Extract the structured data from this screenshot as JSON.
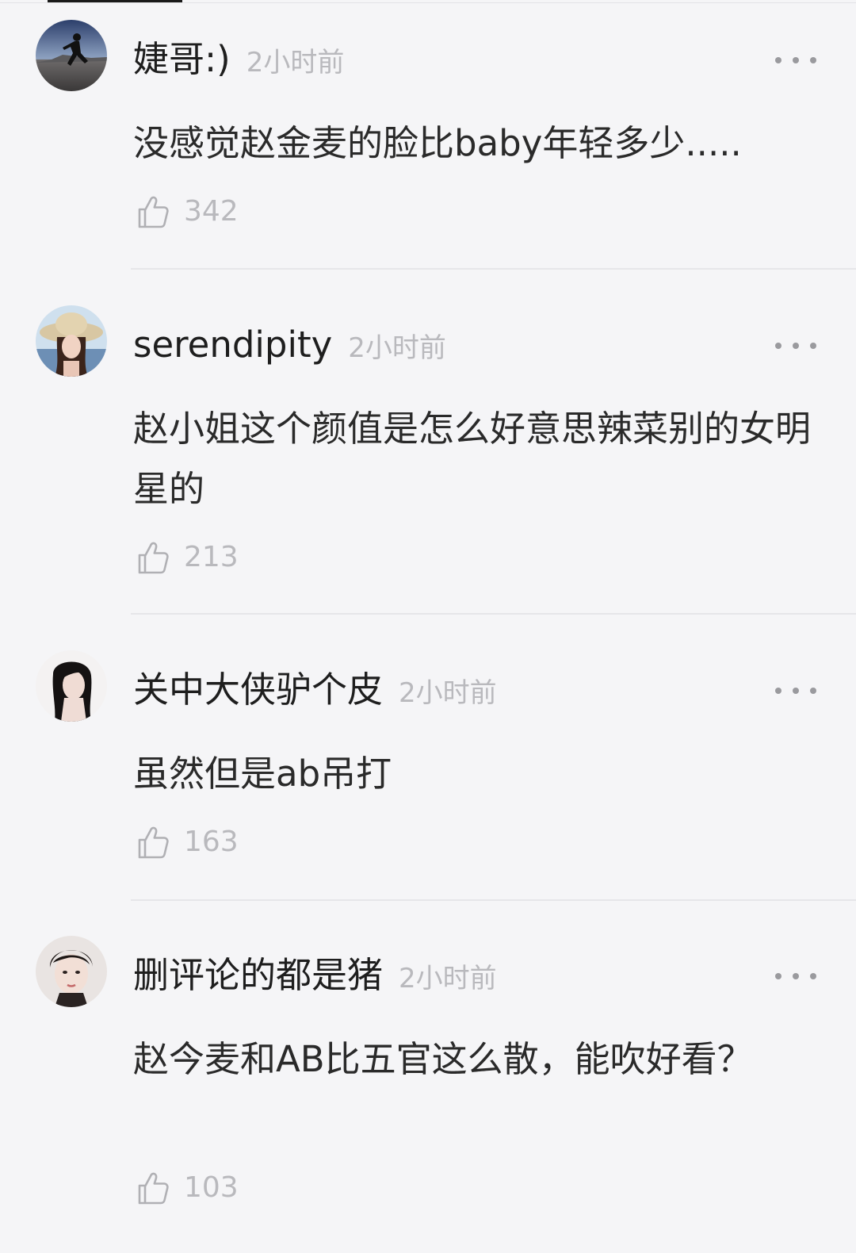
{
  "comments": [
    {
      "username": "婕哥:)",
      "time": "2小时前",
      "text": "没感觉赵金麦的脸比baby年轻多少.....",
      "likes": "342",
      "avatar_icon": "runner-silhouette-avatar"
    },
    {
      "username": "serendipity",
      "time": "2小时前",
      "text": "赵小姐这个颜值是怎么好意思辣菜别的女明星的",
      "likes": "213",
      "avatar_icon": "woman-sunhat-avatar"
    },
    {
      "username": "关中大侠驴个皮",
      "time": "2小时前",
      "text": "虽然但是ab吊打",
      "likes": "163",
      "avatar_icon": "woman-dark-hair-avatar"
    },
    {
      "username": "删评论的都是猪",
      "time": "2小时前",
      "text": "赵今麦和AB比五官这么散，能吹好看？",
      "likes": "103",
      "avatar_icon": "woman-portrait-avatar"
    }
  ],
  "icons": {
    "more": "more-dots-icon",
    "like": "thumbs-up-icon"
  },
  "colors": {
    "background": "#f5f5f7",
    "username": "#1e1e1e",
    "meta": "#b9b9bd",
    "divider": "#e6e6e9"
  }
}
